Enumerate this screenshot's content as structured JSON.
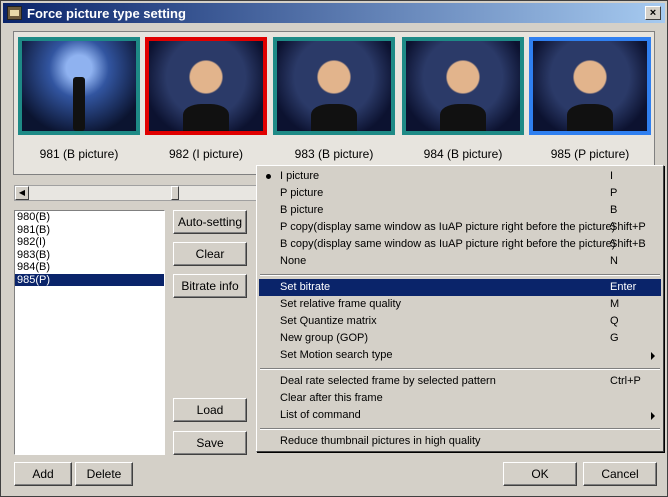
{
  "window": {
    "title": "Force picture type setting",
    "close_label": "×"
  },
  "thumbnails": [
    {
      "caption": "981 (B picture)"
    },
    {
      "caption": "982 (I picture)"
    },
    {
      "caption": "983 (B picture)"
    },
    {
      "caption": "984 (B picture)"
    },
    {
      "caption": "985 (P picture)"
    }
  ],
  "frame_list": [
    "980(B)",
    "981(B)",
    "982(I)",
    "983(B)",
    "984(B)",
    "985(P)"
  ],
  "side_buttons": {
    "auto_setting": "Auto-setting",
    "clear": "Clear",
    "bitrate_info": "Bitrate info",
    "load": "Load",
    "save": "Save"
  },
  "bottom_buttons": {
    "add": "Add",
    "delete": "Delete",
    "ok": "OK",
    "cancel": "Cancel"
  },
  "context_menu": [
    {
      "label": "I picture",
      "key": "I"
    },
    {
      "label": "P picture",
      "key": "P"
    },
    {
      "label": "B picture",
      "key": "B"
    },
    {
      "label": "P copy(display same window as IuAP picture right before the picture)",
      "key": "Shift+P"
    },
    {
      "label": "B copy(display same window as IuAP picture right before the picture)",
      "key": "Shift+B"
    },
    {
      "label": "None",
      "key": "N"
    },
    {
      "label": "Set bitrate",
      "key": "Enter"
    },
    {
      "label": "Set relative frame quality",
      "key": "M"
    },
    {
      "label": "Set Quantize matrix",
      "key": "Q"
    },
    {
      "label": "New group (GOP)",
      "key": "G"
    },
    {
      "label": "Set Motion search type",
      "key": ""
    },
    {
      "label": "Deal rate selected frame by selected pattern",
      "key": "Ctrl+P"
    },
    {
      "label": "Clear after this frame",
      "key": ""
    },
    {
      "label": "List of command",
      "key": ""
    },
    {
      "label": "Reduce thumbnail pictures in high quality",
      "key": ""
    }
  ],
  "colors": {
    "selected_red": "#e00000",
    "selected_blue": "#2f7ff0",
    "teal_border": "#1e8a86",
    "highlight": "#0a246a"
  }
}
